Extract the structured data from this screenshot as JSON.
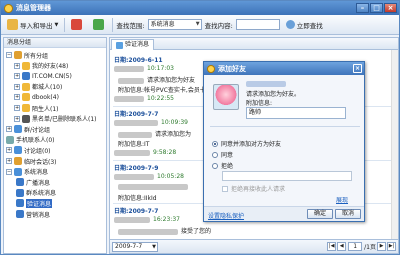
{
  "window": {
    "title": "消息管理器"
  },
  "toolbar": {
    "import_export": "导入和导出",
    "search_scope_label": "查找范围:",
    "search_scope_value": "系统消息",
    "search_content_label": "查找内容:",
    "search_now": "立即查找"
  },
  "sidebar": {
    "header": "消息分组",
    "items": [
      {
        "label": "所有分组",
        "toggle": "−"
      },
      {
        "label": "我的好友(48)",
        "toggle": "+"
      },
      {
        "label": "IT.COM.CN(5)",
        "toggle": "+"
      },
      {
        "label": "都城人(10)",
        "toggle": "+"
      },
      {
        "label": "dbook(4)",
        "toggle": "+"
      },
      {
        "label": "陌生人(1)",
        "toggle": "+"
      },
      {
        "label": "黑名单/已删除联系人(1)",
        "toggle": "+"
      },
      {
        "label": "群/讨论组",
        "toggle": "+"
      },
      {
        "label": "手机联系人(0)",
        "toggle": ""
      },
      {
        "label": "讨论组(0)",
        "toggle": "+"
      },
      {
        "label": "临时会话(3)",
        "toggle": "+"
      },
      {
        "label": "系统消息",
        "toggle": "−"
      },
      {
        "label": "广播消息",
        "toggle": ""
      },
      {
        "label": "群系统消息",
        "toggle": ""
      },
      {
        "label": "验证消息",
        "toggle": ""
      },
      {
        "label": "营销消息",
        "toggle": ""
      }
    ]
  },
  "tab": {
    "label": "验证消息"
  },
  "messages": {
    "date1": "日期:2009-6-11",
    "time1": "10:17:03",
    "line1": "请求添加您为好友",
    "note1": "附加信息:帐号PVC查实卡,会员卡",
    "time2": "10:22:55",
    "date2": "日期:2009-7-7",
    "time3": "10:09:39",
    "line3": "请求添加您为",
    "note3": "附加信息:IT",
    "time4": "9:58:28",
    "date3": "日期:2009-7-9",
    "time5": "10:05:28",
    "note5": "附加信息:IIkId",
    "date4": "日期:2009-7-7",
    "time6": "16:23:37",
    "line6": "接受了您的"
  },
  "pager": {
    "date": "2009-7-7",
    "page": "1",
    "total": "/1页"
  },
  "dialog": {
    "title": "添加好友",
    "request_text": "请求添加您为好友。",
    "extra_label": "附加信息:",
    "extra_value": "路帅",
    "opt_accept_add": "同意并添加对方为好友",
    "opt_accept": "同意",
    "opt_reject": "拒绝",
    "no_more": "拒绝再接收此人请求",
    "collapse": "展现",
    "privacy_link": "设置隐私保护",
    "ok": "确定",
    "cancel": "取消"
  },
  "colors": {
    "title_bar": "#3d72b8",
    "selected": "#316ac5",
    "date_text": "#1a4e9a"
  }
}
